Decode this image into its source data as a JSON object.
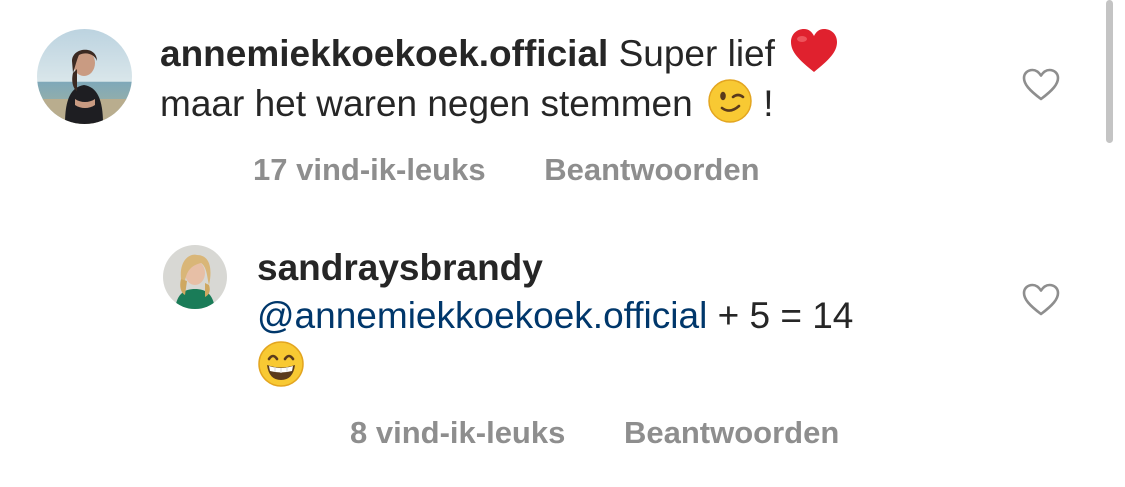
{
  "comments": [
    {
      "username": "annemiekkoekoek.official",
      "text_line1": "Super lief",
      "emoji1": "red-heart",
      "text_line2": "maar het waren negen stemmen",
      "emoji2": "winking-face",
      "text_suffix": "!",
      "likes": "17 vind-ik-leuks",
      "reply_label": "Beantwoorden"
    },
    {
      "username": "sandraysbrandy",
      "mention": "@annemiekkoekoek.official",
      "text": " + 5 = 14",
      "emoji": "grinning-face",
      "likes": "8 vind-ik-leuks",
      "reply_label": "Beantwoorden"
    }
  ],
  "colors": {
    "text": "#262626",
    "meta": "#8e8e8e",
    "mention": "#00376b",
    "heart_emoji": "#e0212e"
  }
}
